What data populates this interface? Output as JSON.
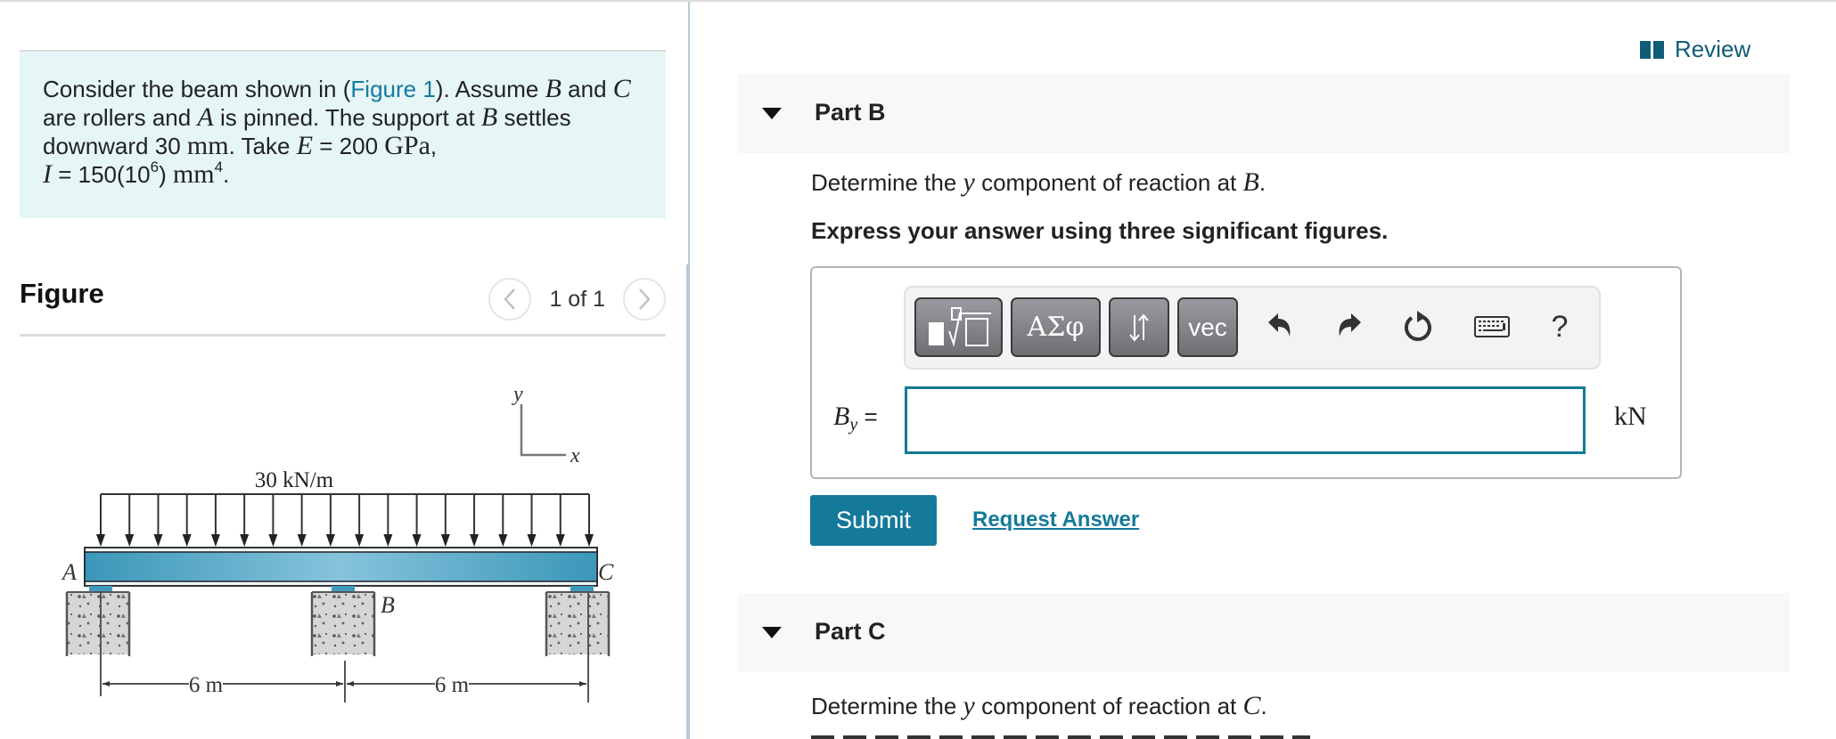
{
  "problem": {
    "text_parts": [
      {
        "type": "text",
        "value": "Consider the beam shown in ("
      },
      {
        "type": "link",
        "value": "Figure 1"
      },
      {
        "type": "text",
        "value": "). Assume "
      },
      {
        "type": "math",
        "value": "B"
      },
      {
        "type": "text",
        "value": " and "
      },
      {
        "type": "math",
        "value": "C"
      },
      {
        "type": "text",
        "value": " are rollers and "
      },
      {
        "type": "math",
        "value": "A"
      },
      {
        "type": "text",
        "value": " is pinned. The support at "
      },
      {
        "type": "math",
        "value": "B"
      },
      {
        "type": "text",
        "value": " settles downward 30 "
      },
      {
        "type": "unit",
        "value": "mm"
      },
      {
        "type": "text",
        "value": ". Take "
      },
      {
        "type": "math",
        "value": "E"
      },
      {
        "type": "text",
        "value": " = 200 "
      },
      {
        "type": "unit",
        "value": "GPa"
      },
      {
        "type": "text",
        "value": ","
      }
    ],
    "line4": {
      "var": "I",
      "eq": " = 150(10",
      "exp": "6",
      "close": ") ",
      "unit": "mm",
      "unit_exp": "4",
      "end": "."
    }
  },
  "figure": {
    "title": "Figure",
    "pager": "1 of 1",
    "prev_icon": "chevron-left-icon",
    "next_icon": "chevron-right-icon",
    "load_label": "30 kN/m",
    "axis_y": "y",
    "axis_x": "x",
    "label_a": "A",
    "label_b": "B",
    "label_c": "C",
    "dim_1": "6 m",
    "dim_2": "6 m",
    "beam_color": "#3e9bbd"
  },
  "review": {
    "label": "Review",
    "icon": "book-icon"
  },
  "part_b": {
    "title": "Part B",
    "question_pre": "Determine the ",
    "question_var": "y",
    "question_mid": " component of reaction at ",
    "question_point": "B",
    "question_end": ".",
    "instruction": "Express your answer using three significant figures.",
    "toolbar": {
      "greek_label": "ΑΣφ",
      "arrows_label": "⇅",
      "vec_label": "vec",
      "help_label": "?"
    },
    "answer": {
      "var": "B",
      "sub": "y",
      "equals": " =",
      "value": "",
      "unit": "kN"
    },
    "submit_label": "Submit",
    "request_label": "Request Answer"
  },
  "part_c": {
    "title": "Part C",
    "question_pre": "Determine the ",
    "question_var": "y",
    "question_mid": " component of reaction at ",
    "question_point": "C",
    "question_end": "."
  },
  "colors": {
    "accent": "#157a9a",
    "link": "#127ba1",
    "problem_bg": "#e6f6f7",
    "review": "#0e5d76"
  }
}
